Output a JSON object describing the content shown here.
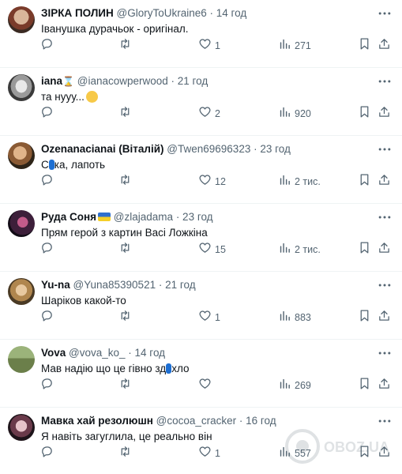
{
  "icons": [
    "more-icon",
    "reply-icon",
    "retweet-icon",
    "like-icon",
    "views-icon",
    "bookmark-icon",
    "share-icon"
  ],
  "watermark": "OBOZ.UA",
  "replies": [
    {
      "name": "ЗІРКА ПОЛИН",
      "handle": "@GloryToUkraine6",
      "time": "· 14 год",
      "text": "Іванушка дурачьок - оригінал.",
      "likes": "1",
      "views": "271"
    },
    {
      "name": "iana",
      "handle": "@ianacowperwood",
      "time": "· 21 год",
      "text": "та нууу...",
      "likes": "2",
      "views": "920"
    },
    {
      "name": "Ozenanacianai (Віталій)",
      "handle": "@Twen69696323",
      "time": "· 23 год",
      "text_a": "С",
      "text_b": "ка, лапоть",
      "likes": "12",
      "views": "2 тис."
    },
    {
      "name": "Руда Соня",
      "handle": "@zlajadama",
      "time": "· 23 год",
      "text": "Прям герой з картин Васі Ложкіна",
      "likes": "15",
      "views": "2 тис."
    },
    {
      "name": "Yu-na",
      "handle": "@Yuna85390521",
      "time": "· 21 год",
      "text": "Шаріков какой-то",
      "likes": "1",
      "views": "883"
    },
    {
      "name": "Vova",
      "handle": "@vova_ko_",
      "time": "· 14 год",
      "text_a": "Мав надію що це гівно зд",
      "text_b": "хло",
      "likes": "",
      "views": "269"
    },
    {
      "name": "Мавка хай резолюшн",
      "handle": "@cocoa_cracker",
      "time": "· 16 год",
      "text": "Я навіть загуглила, це реально він",
      "likes": "1",
      "views": "557"
    }
  ]
}
